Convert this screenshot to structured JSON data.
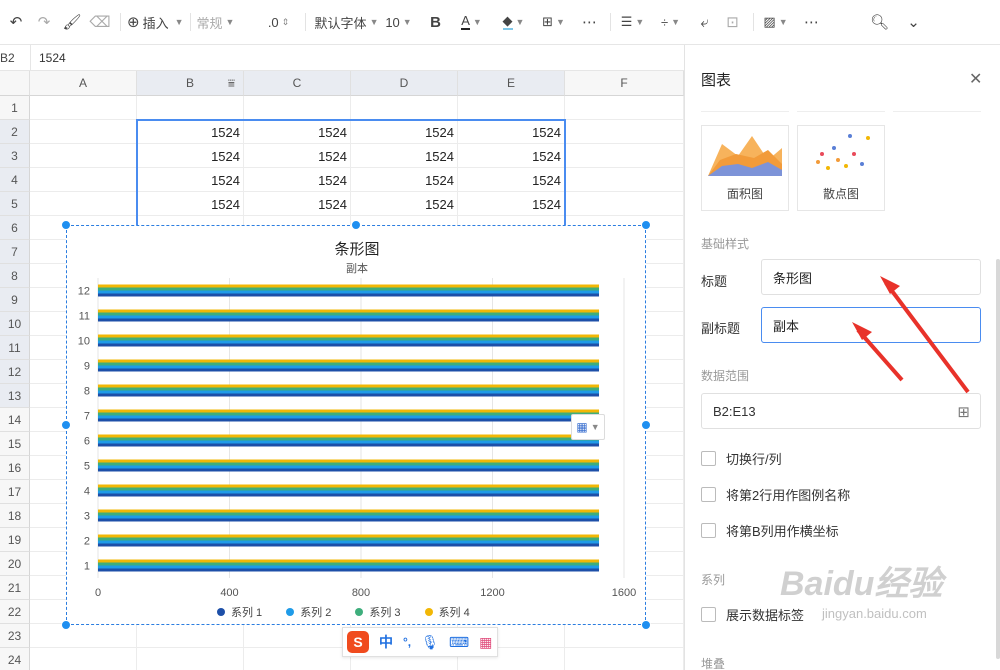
{
  "toolbar": {
    "insert_label": "插入",
    "format_label": "常规",
    "decimal_label": ".0",
    "font_label": "默认字体",
    "fontsize_label": "10"
  },
  "formula": {
    "cell_ref": "B2",
    "value": "1524"
  },
  "grid": {
    "columns": [
      "A",
      "B",
      "C",
      "D",
      "E",
      "F"
    ],
    "rows": [
      "1",
      "2",
      "3",
      "4",
      "5",
      "6",
      "7",
      "8",
      "9",
      "10",
      "11",
      "12",
      "13",
      "14",
      "15",
      "16",
      "17",
      "18",
      "19",
      "20",
      "21",
      "22",
      "23",
      "24"
    ],
    "cell_value": "1524"
  },
  "chart": {
    "title": "条形图",
    "subtitle": "副本"
  },
  "chart_data": {
    "type": "bar",
    "orientation": "horizontal",
    "title": "条形图",
    "subtitle": "副本",
    "categories": [
      "1",
      "2",
      "3",
      "4",
      "5",
      "6",
      "7",
      "8",
      "9",
      "10",
      "11",
      "12"
    ],
    "series": [
      {
        "name": "系列 1",
        "values": [
          1524,
          1524,
          1524,
          1524,
          1524,
          1524,
          1524,
          1524,
          1524,
          1524,
          1524,
          1524
        ]
      },
      {
        "name": "系列 2",
        "values": [
          1524,
          1524,
          1524,
          1524,
          1524,
          1524,
          1524,
          1524,
          1524,
          1524,
          1524,
          1524
        ]
      },
      {
        "name": "系列 3",
        "values": [
          1524,
          1524,
          1524,
          1524,
          1524,
          1524,
          1524,
          1524,
          1524,
          1524,
          1524,
          1524
        ]
      },
      {
        "name": "系列 4",
        "values": [
          1524,
          1524,
          1524,
          1524,
          1524,
          1524,
          1524,
          1524,
          1524,
          1524,
          1524,
          1524
        ]
      }
    ],
    "xticks": [
      "0",
      "400",
      "800",
      "1200",
      "1600"
    ],
    "xlim": [
      0,
      1600
    ],
    "grid": true,
    "legend_position": "bottom",
    "colors": [
      "#1d4fa8",
      "#1f9be8",
      "#3eae7c",
      "#f2b705"
    ]
  },
  "ime": {
    "chinese_label": "中",
    "punct_label": "°,"
  },
  "panel": {
    "title": "图表",
    "chart_types": [
      {
        "label": "面积图"
      },
      {
        "label": "散点图"
      }
    ],
    "basic_style_label": "基础样式",
    "title_label": "标题",
    "title_value": "条形图",
    "subtitle_label": "副标题",
    "subtitle_value": "副本",
    "data_range_label": "数据范围",
    "data_range_value": "B2:E13",
    "checkboxes": [
      {
        "label": "切换行/列"
      },
      {
        "label": "将第2行用作图例名称"
      },
      {
        "label": "将第B列用作横坐标"
      }
    ],
    "series_label": "系列",
    "show_data_labels": "展示数据标签",
    "stack_label": "堆叠"
  },
  "watermark": {
    "brand": "Baidu经验",
    "url": "jingyan.baidu.com"
  }
}
